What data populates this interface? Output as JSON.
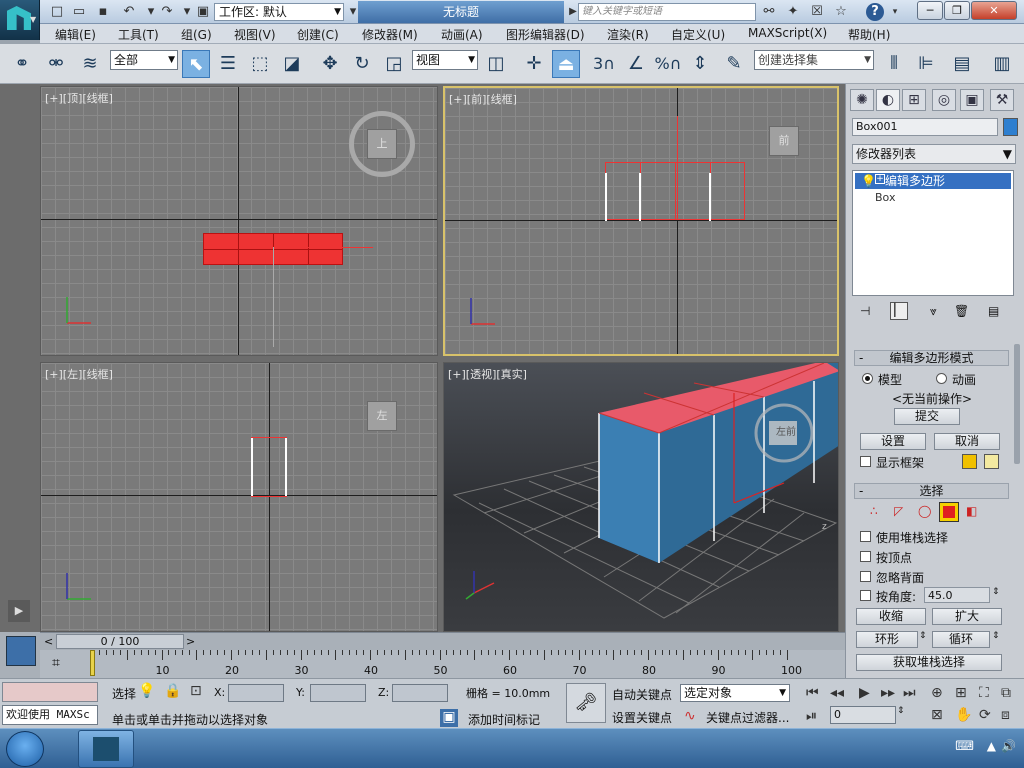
{
  "titlebar": {
    "workspace_label": "工作区: 默认",
    "doc_title": "无标题",
    "search_placeholder": "键入关键字或短语",
    "help_glyph": "?"
  },
  "menu": [
    "编辑(E)",
    "工具(T)",
    "组(G)",
    "视图(V)",
    "创建(C)",
    "修改器(M)",
    "动画(A)",
    "图形编辑器(D)",
    "渲染(R)",
    "自定义(U)",
    "MAXScript(X)",
    "帮助(H)"
  ],
  "toolbar": {
    "filter_value": "全部",
    "refcoord_value": "视图",
    "selection_set_placeholder": "创建选择集",
    "snap_label": "3",
    "percent_label": "%"
  },
  "viewports": {
    "top": {
      "label": "[+][顶][线框]",
      "cube_label": "上"
    },
    "front": {
      "label": "[+][前][线框]",
      "cube_label": "前"
    },
    "left": {
      "label": "[+][左][线框]",
      "cube_label": "左"
    },
    "persp": {
      "label": "[+][透视][真实]",
      "cube_label": "左前"
    }
  },
  "gizmo_axes": {
    "x": "x",
    "y": "y",
    "z": "z"
  },
  "command_panel": {
    "object_name": "Box001",
    "object_color": "#2e7fd0",
    "modifier_list_label": "修改器列表",
    "stack": [
      {
        "label": "编辑多边形",
        "selected": true
      },
      {
        "label": "Box",
        "selected": false
      }
    ],
    "rollout_mode": {
      "title": "编辑多边形模式",
      "radio_model": "模型",
      "radio_anim": "动画",
      "current_op": "<无当前操作>",
      "commit_button": "提交",
      "settings_button": "设置",
      "cancel_button": "取消",
      "show_cage_label": "显示框架",
      "cage_color1": "#f0c000",
      "cage_color2": "#f3e9a0"
    },
    "rollout_select": {
      "title": "选择",
      "use_stack_label": "使用堆栈选择",
      "by_vertex_label": "按顶点",
      "ignore_back_label": "忽略背面",
      "by_angle_label": "按角度:",
      "angle_value": "45.0",
      "shrink_button": "收缩",
      "grow_button": "扩大",
      "ring_button": "环形",
      "loop_button": "循环",
      "get_stack_button": "获取堆栈选择"
    }
  },
  "timeslider": {
    "frame_label": "0 / 100",
    "ticks": [
      "0",
      "10",
      "20",
      "30",
      "40",
      "50",
      "60",
      "70",
      "80",
      "90",
      "100"
    ]
  },
  "statusbar": {
    "welcome_text": "欢迎使用 MAXSc",
    "select_label": "选择",
    "prompt_text": "单击或单击并拖动以选择对象",
    "x_label": "X:",
    "y_label": "Y:",
    "z_label": "Z:",
    "grid_label": "栅格 = 10.0mm",
    "add_time_tag": "添加时间标记",
    "auto_key": "自动关键点",
    "set_key": "设置关键点",
    "key_mode_value": "选定对象",
    "key_filter": "关键点过滤器...",
    "frame_value": "0"
  }
}
